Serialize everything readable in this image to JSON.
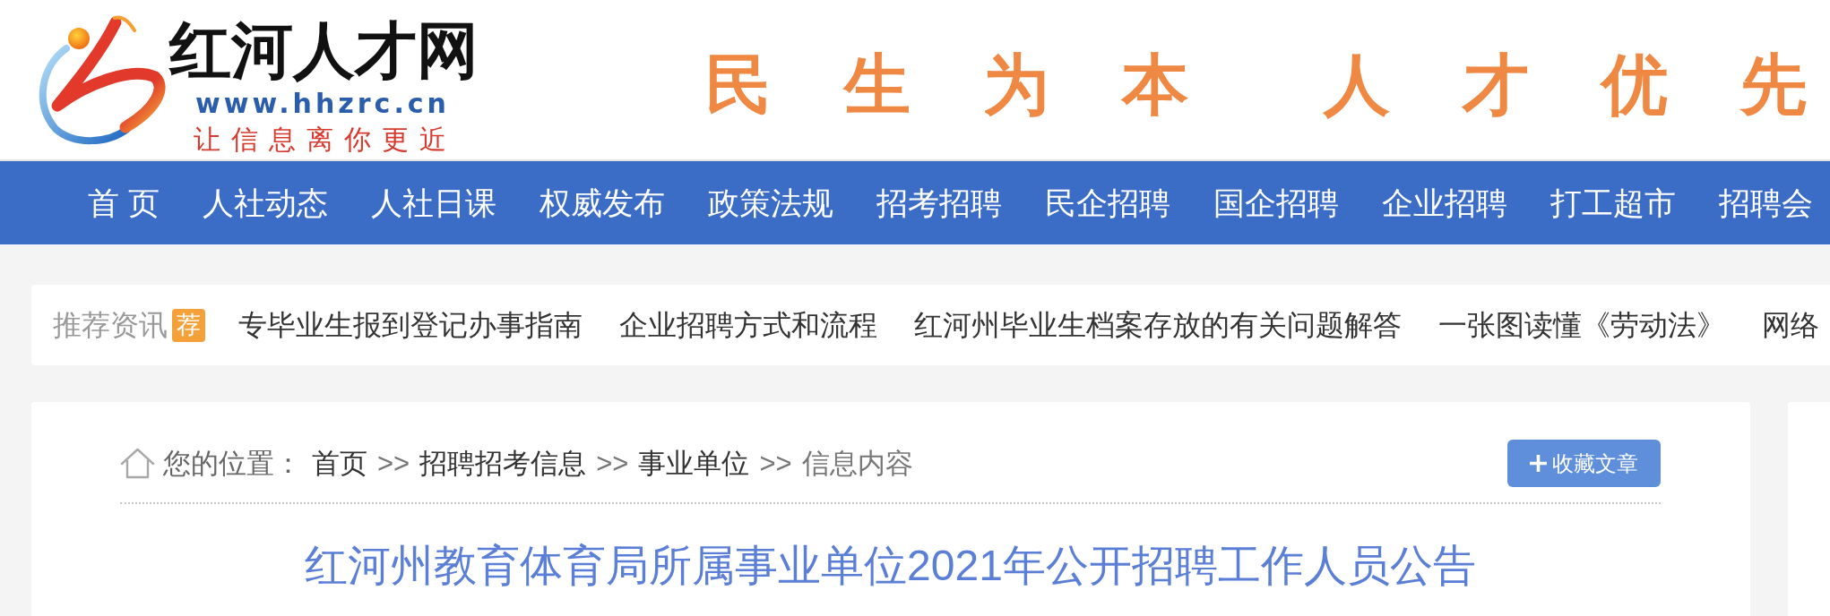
{
  "header": {
    "logo_title": "红河人才网",
    "logo_url": "www.hhzrc.cn",
    "logo_tagline": "让信息离你更近",
    "slogan": [
      "民生为本",
      "人才优先"
    ]
  },
  "nav": [
    "首 页",
    "人社动态",
    "人社日课",
    "权威发布",
    "政策法规",
    "招考招聘",
    "民企招聘",
    "国企招聘",
    "企业招聘",
    "打工超市",
    "招聘会"
  ],
  "recommend": {
    "label": "推荐资讯",
    "tag": "荐",
    "items": [
      "专毕业生报到登记办事指南",
      "企业招聘方式和流程",
      "红河州毕业生档案存放的有关问题解答",
      "一张图读懂《劳动法》",
      "网络"
    ]
  },
  "breadcrumb": {
    "prefix": "您的位置：",
    "parts": [
      {
        "kind": "link",
        "label": "首页"
      },
      {
        "kind": "separator",
        "label": ">>"
      },
      {
        "kind": "link",
        "label": "招聘招考信息"
      },
      {
        "kind": "separator",
        "label": ">>"
      },
      {
        "kind": "link",
        "label": "事业单位"
      },
      {
        "kind": "separator",
        "label": ">>"
      },
      {
        "kind": "current",
        "label": "信息内容"
      }
    ]
  },
  "collect_button": "收藏文章",
  "article": {
    "title": "红河州教育体育局所属事业单位2021年公开招聘工作人员公告"
  }
}
